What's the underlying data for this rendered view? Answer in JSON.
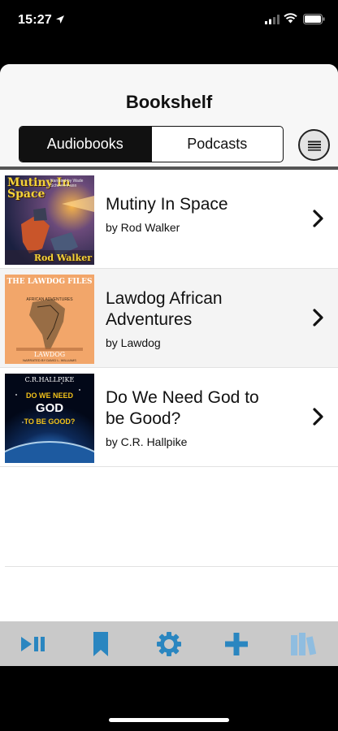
{
  "status_bar": {
    "time": "15:27",
    "icons": [
      "location-arrow-icon",
      "cellular-signal-icon",
      "wifi-icon",
      "battery-icon"
    ]
  },
  "header": {
    "title": "Bookshelf",
    "tabs": [
      {
        "label": "Audiobooks",
        "selected": true
      },
      {
        "label": "Podcasts",
        "selected": false
      }
    ],
    "menu_icon": "list-menu-icon"
  },
  "books": [
    {
      "title_line1": "Mutiny In Space",
      "title_line2": "",
      "author": "by Rod Walker",
      "cover_title": "Mutiny In Space",
      "cover_author": "Rod Walker",
      "cover_note": "Narrated by Wade Schoenemann"
    },
    {
      "title_line1": "Lawdog African",
      "title_line2": "Adventures",
      "author": "by Lawdog",
      "cover_title_top": "THE LAWDOG FILES",
      "cover_subtitle": "AFRICAN ADVENTURES",
      "cover_author": "LAWDOG",
      "cover_note": "NARRATED BY DAVID L. WILLIAMS"
    },
    {
      "title_line1": "Do We Need God to",
      "title_line2": "be Good?",
      "author": "by C.R. Hallpike",
      "cover_author": "C.R.HALLPIKE",
      "cover_l1": "DO WE NEED",
      "cover_l2": "GOD",
      "cover_l3": "TO BE GOOD?"
    }
  ],
  "tab_bar": {
    "items": [
      {
        "icon": "play-pause-icon"
      },
      {
        "icon": "bookmark-icon"
      },
      {
        "icon": "gear-icon"
      },
      {
        "icon": "plus-icon"
      },
      {
        "icon": "library-books-icon"
      }
    ],
    "accent": "#2a86c0",
    "muted_accent": "#8fbde0"
  }
}
